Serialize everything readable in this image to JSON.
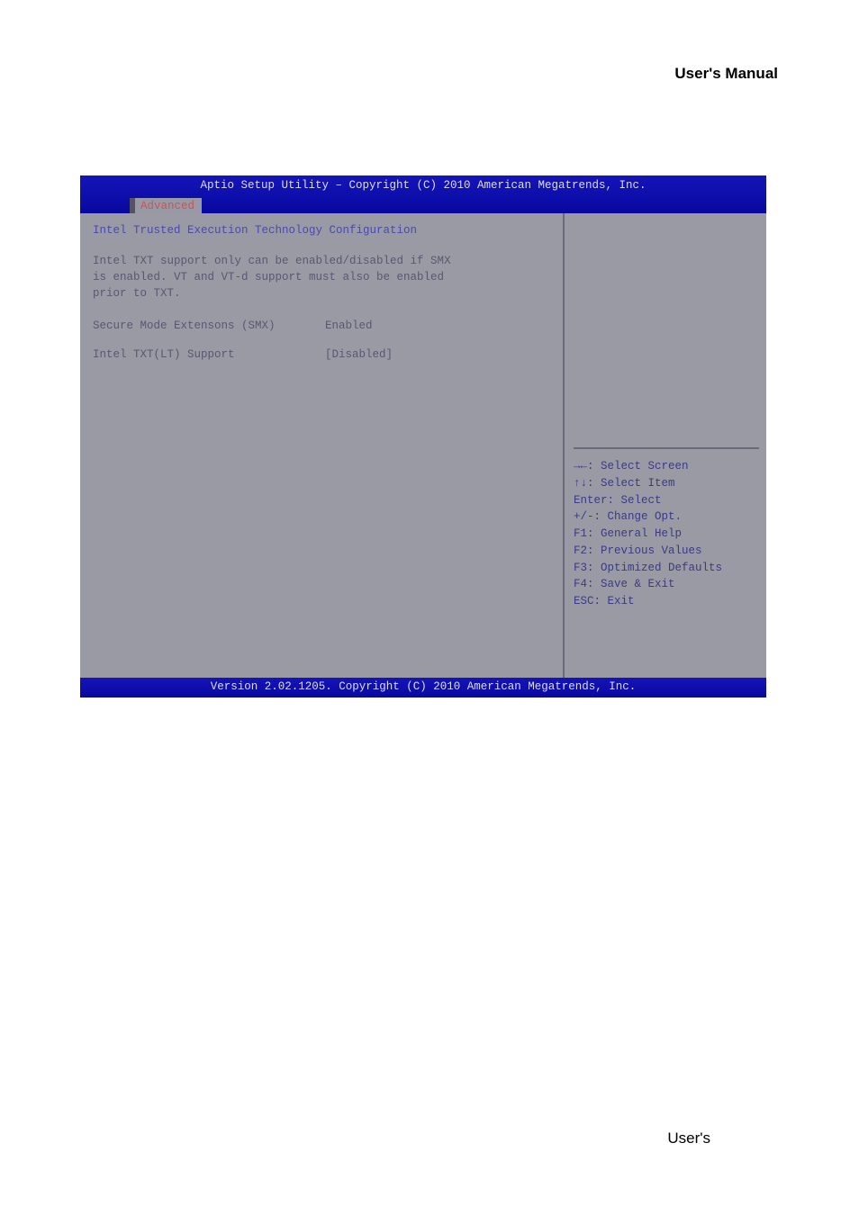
{
  "doc": {
    "header": "User's  Manual",
    "footer": "User's"
  },
  "bios": {
    "title": "Aptio Setup Utility – Copyright (C) 2010 American Megatrends, Inc.",
    "tab": "Advanced",
    "section_title": "Intel Trusted Execution Technology Configuration",
    "info_lines": [
      "Intel TXT support only can be enabled/disabled if SMX",
      "is enabled. VT and VT-d support must also be enabled",
      "prior to TXT."
    ],
    "settings": [
      {
        "label": "Secure Mode Extensons (SMX)",
        "value": "Enabled"
      },
      {
        "label": "Intel TXT(LT) Support",
        "value": "[Disabled]"
      }
    ],
    "help": {
      "keys": [
        "→←: Select Screen",
        "↑↓: Select Item",
        "Enter: Select",
        "+/-: Change Opt.",
        "F1: General Help",
        "F2: Previous Values",
        "F3: Optimized Defaults",
        "F4: Save & Exit",
        "ESC: Exit"
      ]
    },
    "footer": "Version 2.02.1205. Copyright (C) 2010 American Megatrends, Inc."
  }
}
